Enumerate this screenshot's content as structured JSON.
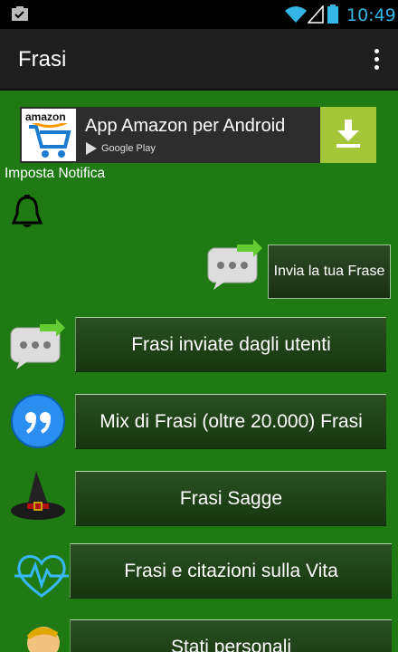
{
  "status_bar": {
    "time": "10:49",
    "clock_color": "#33b5e5"
  },
  "action_bar": {
    "title": "Frasi"
  },
  "ad": {
    "title": "App Amazon per Android",
    "store": "Google Play",
    "brand": "amazon",
    "download_color": "#a4c639"
  },
  "notification": {
    "label": "Imposta Notifica"
  },
  "send_phrase": {
    "label": "Invia la tua Frase"
  },
  "menu": {
    "items": [
      {
        "label": "Frasi inviate dagli utenti",
        "icon": "message-bubble-icon"
      },
      {
        "label": "Mix di Frasi (oltre 20.000) Frasi",
        "icon": "quote-bubble-icon"
      },
      {
        "label": "Frasi Sagge",
        "icon": "witch-hat-icon"
      },
      {
        "label": "Frasi e citazioni sulla Vita",
        "icon": "heartbeat-icon"
      },
      {
        "label": "Stati personali",
        "icon": "person-icon"
      }
    ]
  },
  "colors": {
    "background": "#1f7a14",
    "action_bar": "#1e1e1e",
    "button": "#1f3f19"
  }
}
